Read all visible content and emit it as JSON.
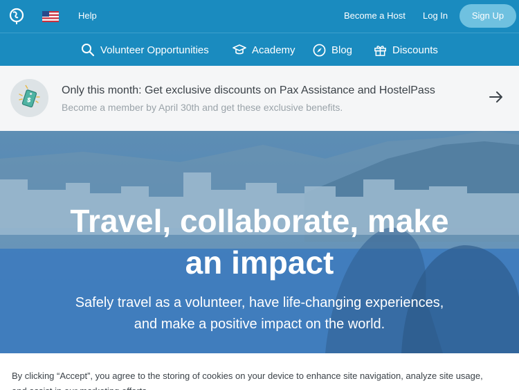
{
  "topbar": {
    "logo_icon": "globe-pin-icon",
    "flag_icon": "us-flag-icon",
    "help_label": "Help",
    "become_host_label": "Become a Host",
    "login_label": "Log In",
    "signup_label": "Sign Up"
  },
  "nav": {
    "items": [
      {
        "label": "Volunteer Opportunities",
        "icon": "search-icon"
      },
      {
        "label": "Academy",
        "icon": "graduation-cap-icon"
      },
      {
        "label": "Blog",
        "icon": "compass-icon"
      },
      {
        "label": "Discounts",
        "icon": "gift-icon"
      }
    ]
  },
  "promo": {
    "icon": "tag-icon",
    "title": "Only this month: Get exclusive discounts on Pax Assistance and HostelPass",
    "subtitle": "Become a member by April 30th and get these exclusive benefits.",
    "arrow_icon": "arrow-right-icon"
  },
  "hero": {
    "title": "Travel, collaborate, make an impact",
    "subtitle_line1": "Safely travel as a volunteer, have life-changing experiences,",
    "subtitle_line2": "and make a positive impact on the world."
  },
  "cookie": {
    "text": "By clicking “Accept”, you agree to the storing of cookies on your device to enhance site navigation, analyze site usage, and assist in our marketing efforts."
  },
  "colors": {
    "brand_blue": "#1a8bbf",
    "signup_button": "#6fc1e0",
    "promo_bg": "#f5f6f7"
  }
}
